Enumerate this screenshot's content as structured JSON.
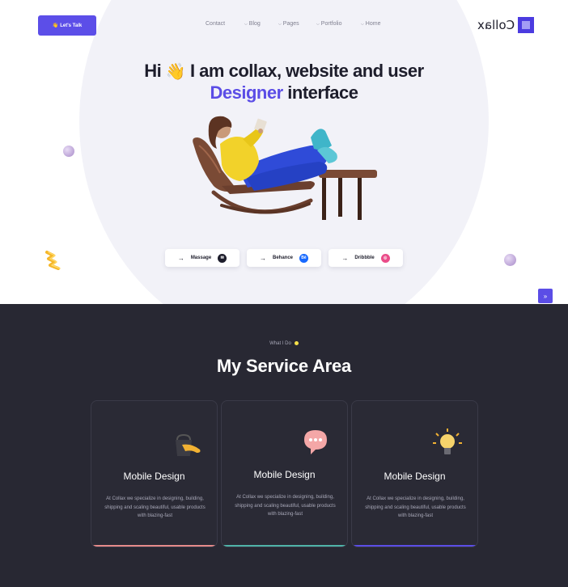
{
  "header": {
    "cta_label": "Let's Talk",
    "cta_icon": "👋",
    "nav": [
      {
        "label": "Contact",
        "has_dropdown": false
      },
      {
        "label": "Blog",
        "has_dropdown": true
      },
      {
        "label": "Pages",
        "has_dropdown": true
      },
      {
        "label": "Portfolio",
        "has_dropdown": true
      },
      {
        "label": "Home",
        "has_dropdown": true
      }
    ],
    "logo_text": "Collax",
    "logo_icon": "square-logo-icon"
  },
  "hero": {
    "line1_prefix": "Hi",
    "wave_emoji": "👋",
    "line1_suffix": "I am collax, website and user",
    "line2_accent": "Designer",
    "line2_rest": "interface",
    "illustration": "woman-in-rocking-chair-reading-illustration",
    "buttons": [
      {
        "label": "Massage",
        "icon": "mail-icon",
        "icon_glyph": "✉",
        "icon_color": "#1d1d2b"
      },
      {
        "label": "Behance",
        "icon": "behance-icon",
        "icon_glyph": "Bē",
        "icon_color": "#1769ff"
      },
      {
        "label": "Dribbble",
        "icon": "dribbble-icon",
        "icon_glyph": "◎",
        "icon_color": "#ea4c89"
      }
    ],
    "accent_color": "#5b4de6",
    "scroll_top_icon": "double-chevron-up-icon"
  },
  "services": {
    "eyebrow": "What I Do",
    "title": "My Service Area",
    "cards": [
      {
        "title": "Mobile Design",
        "desc": "At Collax we specialize in designing, building, shipping and scaling beautiful, usable products with blazing-fast",
        "icon": "paint-bucket-icon",
        "bar_color": "#e58a8a"
      },
      {
        "title": "Mobile Design",
        "desc": "At Collax we specialize in designing, building, shipping and scaling beautiful, usable products with blazing-fast",
        "icon": "chat-bubble-icon",
        "bar_color": "#4fb3a8"
      },
      {
        "title": "Mobile Design",
        "desc": "At Collax we specialize in designing, building, shipping and scaling beautiful, usable products with blazing-fast",
        "icon": "light-bulb-icon",
        "bar_color": "#5b4de6"
      }
    ]
  }
}
